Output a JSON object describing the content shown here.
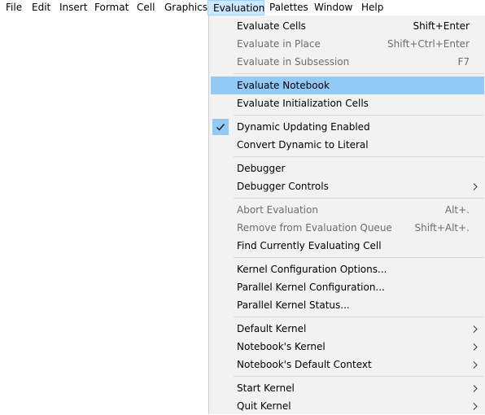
{
  "menubar": {
    "items": [
      "File",
      "Edit",
      "Insert",
      "Format",
      "Cell",
      "Graphics",
      "Evaluation",
      "Palettes",
      "Window",
      "Help"
    ],
    "open_item": "Evaluation"
  },
  "menu": {
    "evaluate_cells": {
      "label": "Evaluate Cells",
      "shortcut": "Shift+Enter"
    },
    "evaluate_in_place": {
      "label": "Evaluate in Place",
      "shortcut": "Shift+Ctrl+Enter"
    },
    "evaluate_in_subsession": {
      "label": "Evaluate in Subsession",
      "shortcut": "F7"
    },
    "evaluate_notebook": {
      "label": "Evaluate Notebook"
    },
    "evaluate_initialization_cells": {
      "label": "Evaluate Initialization Cells"
    },
    "dynamic_updating_enabled": {
      "label": "Dynamic Updating Enabled",
      "checked": true
    },
    "convert_dynamic_to_literal": {
      "label": "Convert Dynamic to Literal"
    },
    "debugger": {
      "label": "Debugger"
    },
    "debugger_controls": {
      "label": "Debugger Controls"
    },
    "abort_evaluation": {
      "label": "Abort Evaluation",
      "shortcut": "Alt+."
    },
    "remove_from_evaluation_queue": {
      "label": "Remove from Evaluation Queue",
      "shortcut": "Shift+Alt+."
    },
    "find_currently_evaluating_cell": {
      "label": "Find Currently Evaluating Cell"
    },
    "kernel_configuration_options": {
      "label": "Kernel Configuration Options..."
    },
    "parallel_kernel_configuration": {
      "label": "Parallel Kernel Configuration..."
    },
    "parallel_kernel_status": {
      "label": "Parallel Kernel Status..."
    },
    "default_kernel": {
      "label": "Default Kernel"
    },
    "notebooks_kernel": {
      "label": "Notebook's Kernel"
    },
    "notebooks_default_context": {
      "label": "Notebook's Default Context"
    },
    "start_kernel": {
      "label": "Start Kernel"
    },
    "quit_kernel": {
      "label": "Quit Kernel"
    }
  },
  "icons": {
    "check": "checkmark-icon",
    "submenu": "chevron-right-icon"
  },
  "colors": {
    "menu_background": "#f2f2f2",
    "highlight": "#91c9f7",
    "menubar_open": "#cce8ff",
    "disabled_text": "#6d6d6d"
  }
}
